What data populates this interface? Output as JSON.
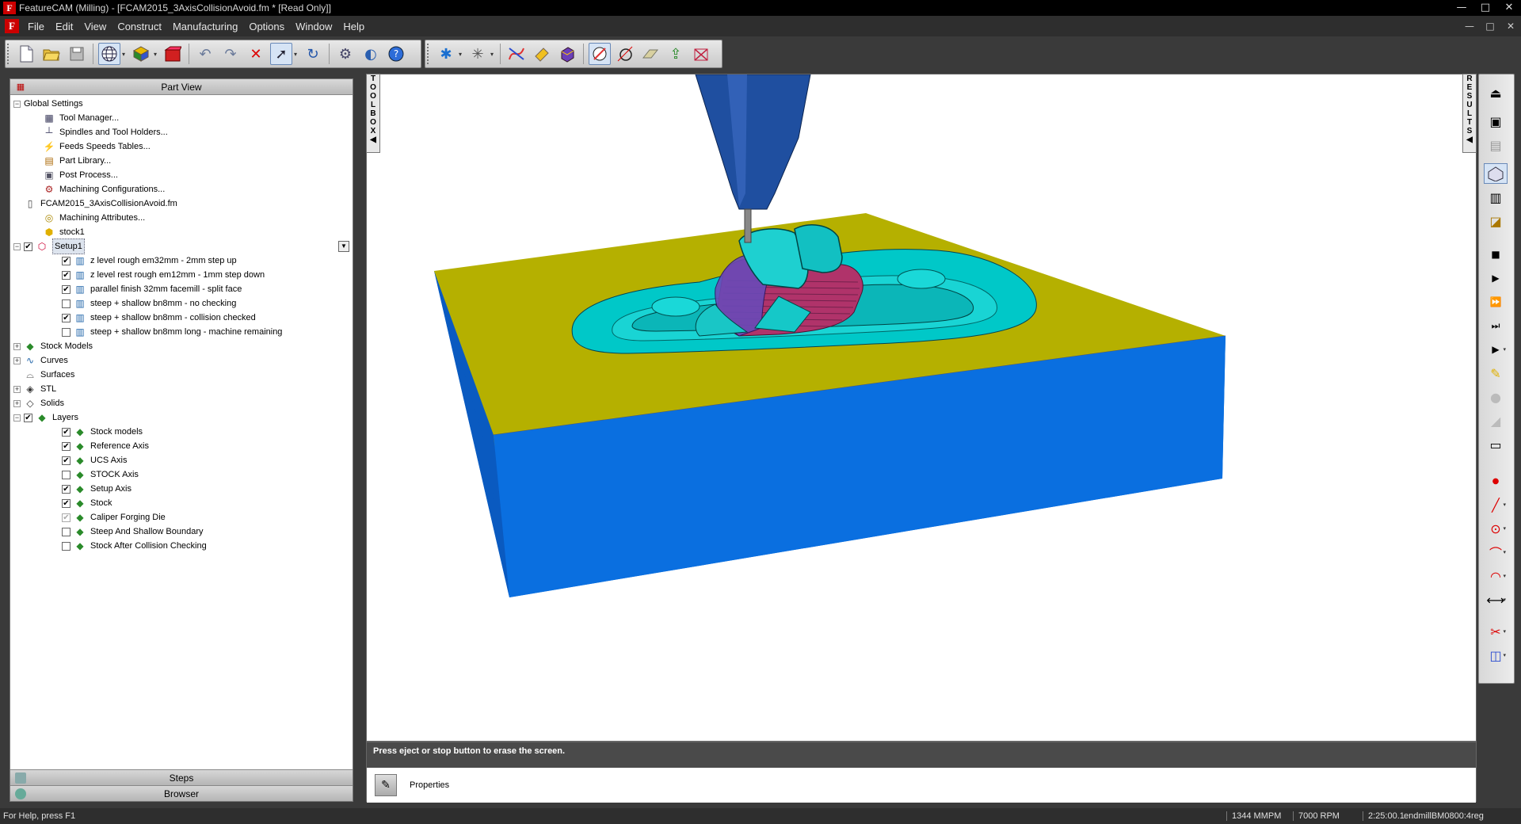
{
  "window": {
    "title": "FeatureCAM (Milling) - [FCAM2015_3AxisCollisionAvoid.fm * [Read Only]]",
    "controls": [
      "—",
      "□",
      "✕"
    ]
  },
  "menu": {
    "items": [
      "File",
      "Edit",
      "View",
      "Construct",
      "Manufacturing",
      "Options",
      "Window",
      "Help"
    ],
    "mdi_controls": [
      "—",
      "□",
      "✕"
    ]
  },
  "toolbar": {
    "icons": [
      "new-file-icon",
      "open-folder-icon",
      "save-icon",
      "view-globe-icon",
      "color-layer-icon",
      "stock-icon",
      "undo-icon",
      "redo-icon",
      "delete-icon",
      "select-pointer-icon",
      "rotate-icon",
      "setup-icon",
      "simulate-icon",
      "help-icon",
      "snap-icon",
      "grid-icon",
      "curve-icon",
      "feature-icon",
      "solid-icon",
      "measure-icon",
      "circle-icon",
      "surface-icon",
      "export-icon",
      "toolpath-icon"
    ]
  },
  "part_view": {
    "header": "Part View",
    "tree": [
      {
        "label": "Global Settings",
        "level": 0,
        "expander": "−",
        "icon": ""
      },
      {
        "label": "Tool Manager...",
        "level": 1,
        "icon": "tool-manager-icon"
      },
      {
        "label": "Spindles and Tool Holders...",
        "level": 1,
        "icon": "spindle-icon"
      },
      {
        "label": "Feeds  Speeds Tables...",
        "level": 1,
        "icon": "feeds-icon"
      },
      {
        "label": "Part Library...",
        "level": 1,
        "icon": "part-library-icon"
      },
      {
        "label": "Post Process...",
        "level": 1,
        "icon": "post-process-icon"
      },
      {
        "label": "Machining Configurations...",
        "level": 1,
        "icon": "machining-config-icon"
      },
      {
        "label": "FCAM2015_3AxisCollisionAvoid.fm",
        "level": 0,
        "icon": "document-icon"
      },
      {
        "label": "Machining Attributes...",
        "level": 1,
        "icon": "attributes-icon"
      },
      {
        "label": "stock1",
        "level": 1,
        "icon": "stock-icon"
      },
      {
        "label": "Setup1",
        "level": 0,
        "expander": "−",
        "check": "on",
        "icon": "setup-icon",
        "selected": true
      },
      {
        "label": "z level rough em32mm - 2mm step up",
        "level": 2,
        "check": "on",
        "icon": "operation-icon"
      },
      {
        "label": "z level rest rough em12mm - 1mm step down",
        "level": 2,
        "check": "on",
        "icon": "operation-icon"
      },
      {
        "label": "parallel finish 32mm facemill - split face",
        "level": 2,
        "check": "on",
        "icon": "operation-icon"
      },
      {
        "label": "steep + shallow bn8mm - no checking",
        "level": 2,
        "check": "off",
        "icon": "operation-icon"
      },
      {
        "label": "steep + shallow bn8mm - collision checked",
        "level": 2,
        "check": "on",
        "icon": "operation-icon"
      },
      {
        "label": "steep + shallow bn8mm long - machine remaining",
        "level": 2,
        "check": "off",
        "icon": "operation-icon"
      },
      {
        "label": "Stock Models",
        "level": 0,
        "expander": "+",
        "icon": "stock-models-icon"
      },
      {
        "label": "Curves",
        "level": 0,
        "expander": "+",
        "icon": "curve-icon"
      },
      {
        "label": "Surfaces",
        "level": 0,
        "icon": "surface-icon"
      },
      {
        "label": "STL",
        "level": 0,
        "expander": "+",
        "icon": "stl-icon"
      },
      {
        "label": "Solids",
        "level": 0,
        "expander": "+",
        "icon": "solid-icon"
      },
      {
        "label": "Layers",
        "level": 0,
        "expander": "−",
        "check": "on",
        "icon": "layers-icon"
      },
      {
        "label": "Stock models",
        "level": 2,
        "check": "on",
        "icon": "layer-icon"
      },
      {
        "label": "Reference Axis",
        "level": 2,
        "check": "on",
        "icon": "layer-icon"
      },
      {
        "label": "UCS Axis",
        "level": 2,
        "check": "on",
        "icon": "layer-icon"
      },
      {
        "label": "STOCK Axis",
        "level": 2,
        "check": "off",
        "icon": "layer-icon"
      },
      {
        "label": "Setup Axis",
        "level": 2,
        "check": "on",
        "icon": "layer-icon"
      },
      {
        "label": "Stock",
        "level": 2,
        "check": "on",
        "icon": "layer-icon"
      },
      {
        "label": "Caliper Forging Die",
        "level": 2,
        "check": "dim",
        "icon": "layer-icon"
      },
      {
        "label": "Steep And Shallow Boundary",
        "level": 2,
        "check": "off",
        "icon": "layer-icon"
      },
      {
        "label": "Stock After Collision Checking",
        "level": 2,
        "check": "off",
        "icon": "layer-icon"
      }
    ],
    "tabs": [
      "Steps",
      "Browser"
    ]
  },
  "viewport": {
    "toolbox_label": "TOOLBOX",
    "results_label": "RESULTS",
    "colors": {
      "top": "#b5b000",
      "side": "#0a6fe0",
      "cavity": "#00c8c8",
      "rest": "#b0336a",
      "holder": "#1f4fa0"
    }
  },
  "message": "Press eject or stop button to erase the screen.",
  "properties_label": "Properties",
  "status": {
    "help": "For Help, press F1",
    "feed": "1344 MMPM",
    "rpm": "7000 RPM",
    "time": "2:25:00.1",
    "tool": "endmillBM0800:4reg"
  },
  "right_strip": {
    "icons": [
      "eject-icon",
      "shaded-view-icon",
      "wireframe-icon",
      "3d-sim-icon",
      "toolpath-sim-icon",
      "tool-icon",
      "stop-icon",
      "play-icon",
      "fast-forward-icon",
      "step-icon",
      "step-feature-icon",
      "pencil-eraser-icon",
      "sphere-icon",
      "surface-sim-icon",
      "slider-icon",
      "point-icon",
      "line-icon",
      "circle-icon",
      "arc-icon",
      "fillet-icon",
      "dimension-icon",
      "trim-icon",
      "boundary-icon"
    ]
  }
}
